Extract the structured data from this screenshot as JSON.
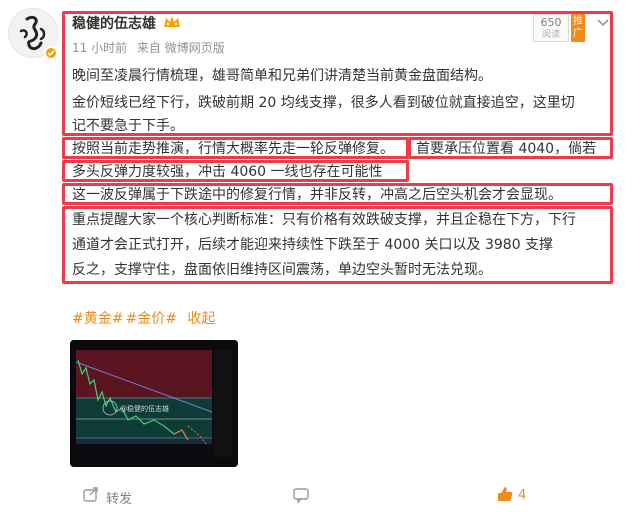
{
  "post": {
    "author": "稳健的伍志雄",
    "time": "11 小时前",
    "source": "来自 微博网页版",
    "rank": {
      "number": "650",
      "caption": "阅读"
    },
    "promo_tag": "推广",
    "paragraphs": [
      {
        "lines": [
          "晚间至凌晨行情梳理，雄哥简单和兄弟们讲清楚当前黄金盘面结构。"
        ]
      },
      {
        "lines": [
          "金价短线已经下行，跌破前期 20 均线支撑，很多人看到破位就直接追空，这里切",
          "记不要急于下手。"
        ]
      },
      {
        "lines": [
          "按照当前走势推演，行情大概率先走一轮反弹修复。"
        ]
      },
      {
        "lines": [
          "首要承压位置看 4040，倘若"
        ]
      },
      {
        "lines": [
          "多头反弹力度较强，冲击 4060 一线也存在可能性"
        ]
      },
      {
        "lines": [
          "这一波反弹属于下跌途中的修复行情，并非反转，冲高之后空头机会才会显现。"
        ]
      },
      {
        "lines": [
          "重点提醒大家一个核心判断标准：只有价格有效跌破支撑，并且企稳在下方，下行",
          "通道才会正式打开，后续才能迎来持续性下跌至于 4000 关口以及 3980 支撑",
          "反之，支撑守住，盘面依旧维持区间震荡，单边空头暂时无法兑现。"
        ]
      }
    ],
    "hashtags": [
      "#黄金#",
      "#金价#",
      "收起"
    ],
    "image_watermark": "@稳健的伍志雄",
    "footer": {
      "forward_label": "转发",
      "like_count": "4"
    }
  },
  "colors": {
    "highlight_border": "#ee3b4a",
    "accent_orange": "#f08a19",
    "text": "#333333",
    "meta": "#939393"
  }
}
